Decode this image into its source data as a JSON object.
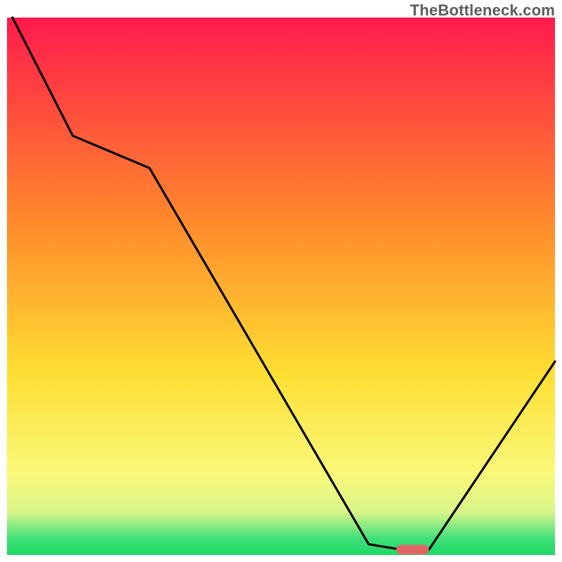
{
  "watermark": "TheBottleneck.com",
  "colors": {
    "gradient_top": "#ff1a4d",
    "gradient_mid1": "#ff8a2b",
    "gradient_mid2": "#ffde33",
    "gradient_mid3": "#f9f97a",
    "gradient_band_pale": "#d9f58a",
    "gradient_band_green": "#3fe07a",
    "gradient_bottom": "#1ed964",
    "curve": "#000000",
    "marker": "#e06666"
  },
  "chart_data": {
    "type": "line",
    "title": "",
    "xlabel": "",
    "ylabel": "",
    "xlim": [
      0,
      100
    ],
    "ylim": [
      0,
      100
    ],
    "series": [
      {
        "name": "bottleneck-curve",
        "x": [
          1,
          12,
          26,
          66,
          72,
          77,
          100
        ],
        "values": [
          100,
          78,
          72,
          2,
          1,
          1,
          36
        ]
      }
    ],
    "annotations": [
      {
        "name": "optimal-marker",
        "shape": "pill",
        "x_center": 74,
        "y_center": 1,
        "width": 6,
        "height": 1.8
      }
    ],
    "gradient_bands_y": {
      "red_top": 100,
      "yellow_peak": 30,
      "pale_band": 10,
      "green_bottom": 0
    }
  }
}
